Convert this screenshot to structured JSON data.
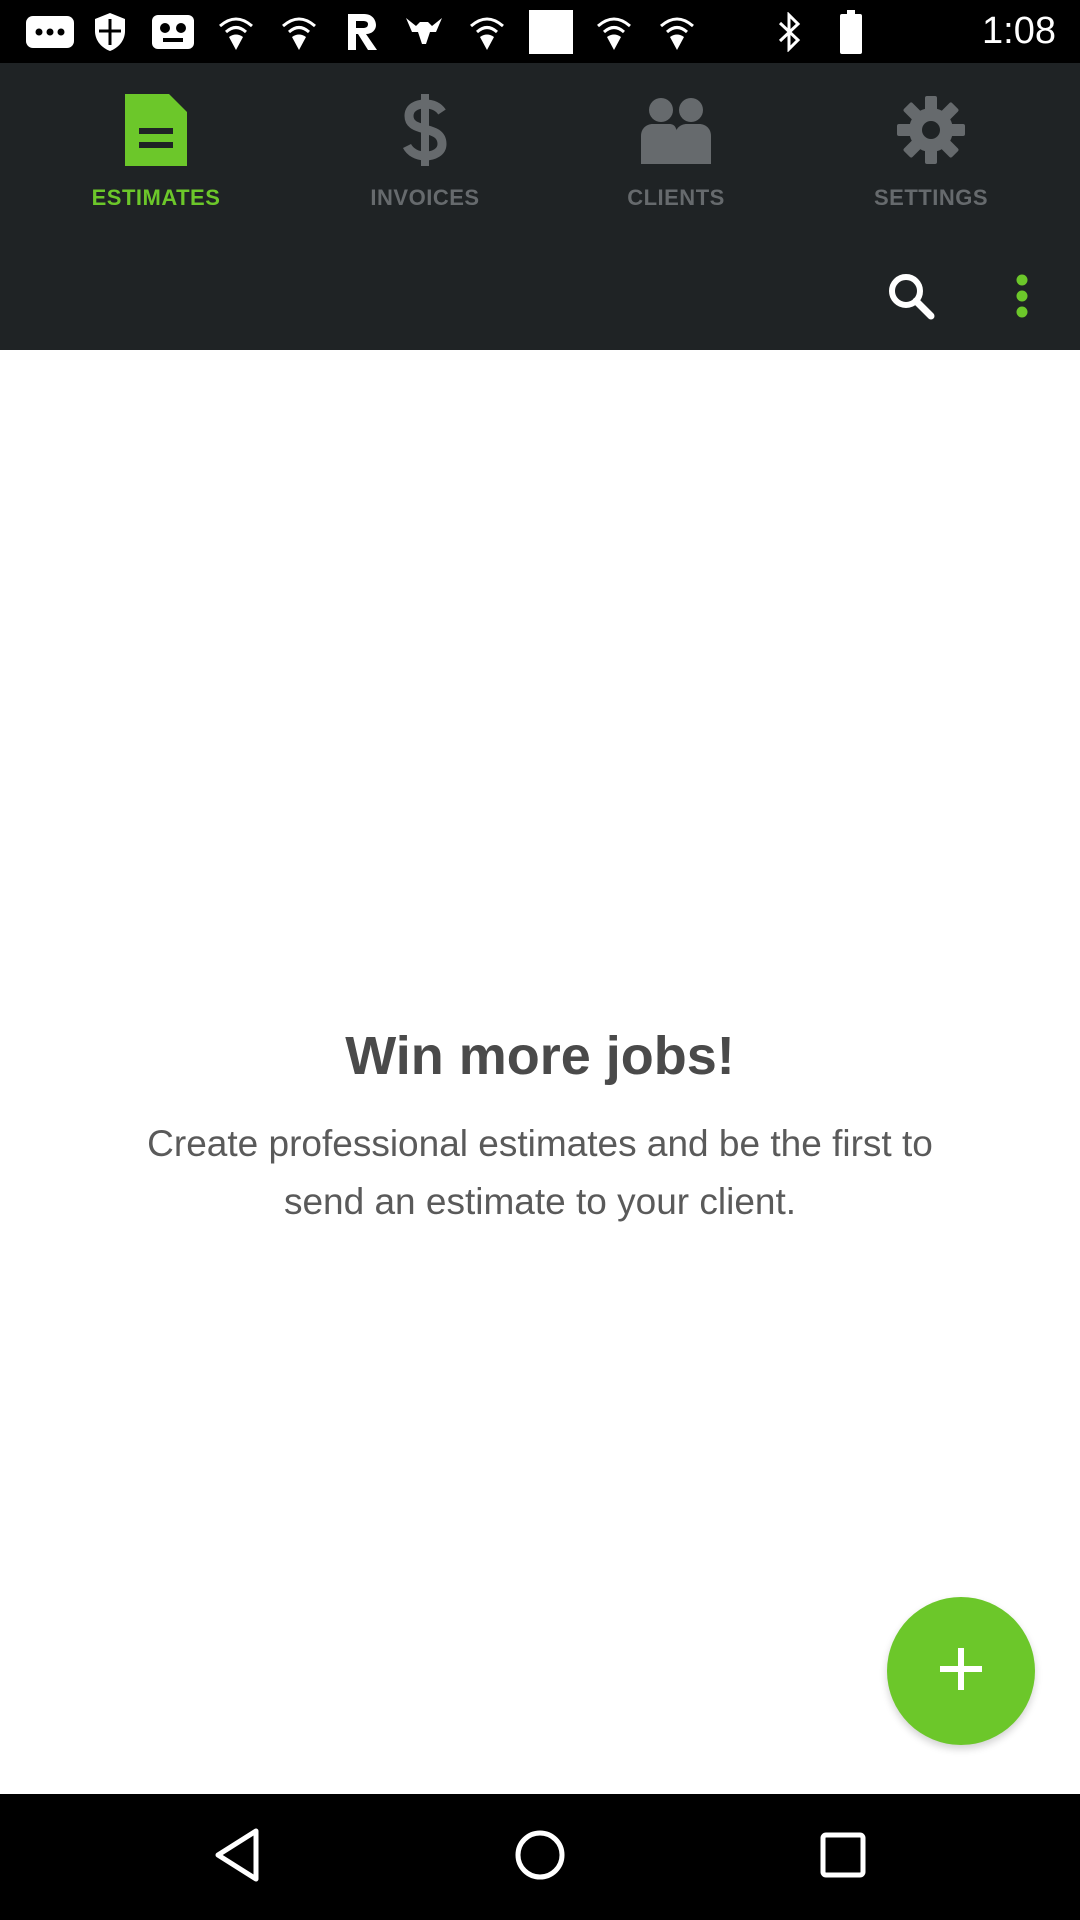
{
  "status_bar": {
    "time": "1:08",
    "icons": [
      "more-icon",
      "shield-icon",
      "gamepad-icon",
      "wifi-icon",
      "wifi-icon",
      "r-app-icon",
      "bull-icon",
      "wifi-icon",
      "blank-icon",
      "wifi-icon",
      "wifi-icon",
      "bluetooth-icon",
      "battery-icon"
    ]
  },
  "tabs": [
    {
      "label": "ESTIMATES",
      "icon": "document-icon",
      "active": true
    },
    {
      "label": "INVOICES",
      "icon": "dollar-icon",
      "active": false
    },
    {
      "label": "CLIENTS",
      "icon": "people-icon",
      "active": false
    },
    {
      "label": "SETTINGS",
      "icon": "gear-icon",
      "active": false
    }
  ],
  "actions": {
    "search_icon": "search-icon",
    "menu_icon": "more-vertical-icon"
  },
  "empty_state": {
    "title": "Win more jobs!",
    "description": "Create professional estimates and be the first to send an estimate to your client."
  },
  "fab": {
    "icon": "plus-icon"
  },
  "colors": {
    "accent": "#6cc72a",
    "app_bar": "#1f2325",
    "inactive_tab": "#666a6d"
  },
  "nav_bar": {
    "icons": [
      "back-icon",
      "home-icon",
      "recents-icon"
    ]
  }
}
